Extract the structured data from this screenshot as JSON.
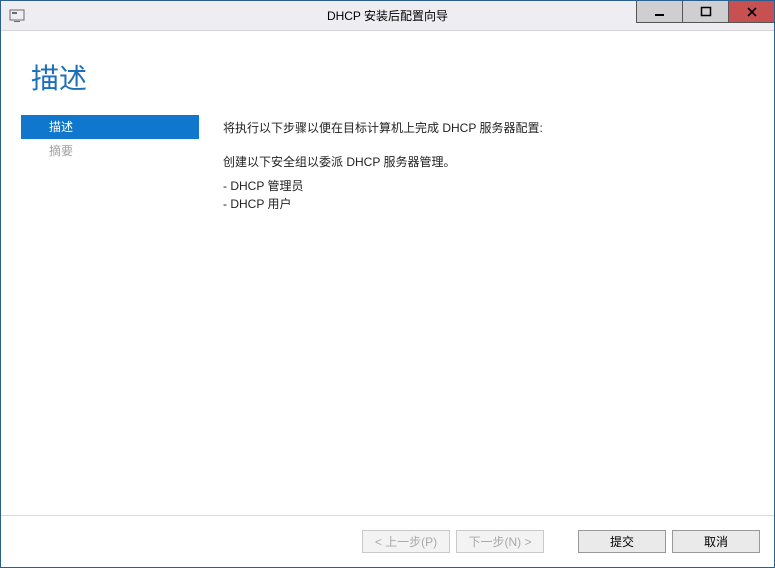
{
  "titlebar": {
    "title": "DHCP 安装后配置向导"
  },
  "heading": "描述",
  "sidebar": {
    "items": [
      {
        "label": "描述",
        "active": true
      },
      {
        "label": "摘要",
        "active": false
      }
    ]
  },
  "main": {
    "intro": "将执行以下步骤以便在目标计算机上完成 DHCP 服务器配置:",
    "group_line": "创建以下安全组以委派 DHCP 服务器管理。",
    "item1": "- DHCP 管理员",
    "item2": "- DHCP 用户"
  },
  "footer": {
    "prev": "< 上一步(P)",
    "next": "下一步(N) >",
    "commit": "提交",
    "cancel": "取消"
  }
}
